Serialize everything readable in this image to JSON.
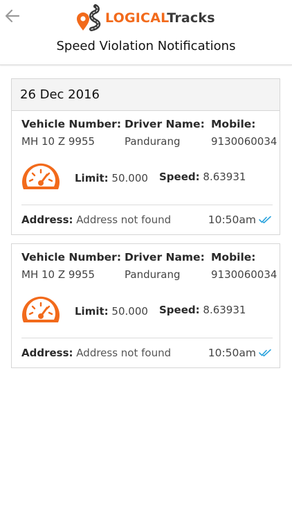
{
  "app": {
    "logo_part1": "LOGICAL",
    "logo_part2": "Tracks",
    "title": "Speed Violation Notifications"
  },
  "colors": {
    "accent": "#f26a1b",
    "check": "#2aa3dd"
  },
  "icons": {
    "back": "arrow-left-icon",
    "speed": "speedometer-icon",
    "read": "double-check-icon"
  },
  "notifications": {
    "date": "26 Dec 2016",
    "items": [
      {
        "vehicle_label": "Vehicle Number:",
        "vehicle_value": "MH 10 Z 9955",
        "driver_label": "Driver Name:",
        "driver_value": "Pandurang",
        "mobile_label": "Mobile:",
        "mobile_value": "9130060034",
        "limit_label": "Limit:",
        "limit_value": "50.000",
        "speed_label": "Speed:",
        "speed_value": "8.63931",
        "address_label": "Address:",
        "address_value": "Address not found",
        "time": "10:50am"
      },
      {
        "vehicle_label": "Vehicle Number:",
        "vehicle_value": "MH 10 Z 9955",
        "driver_label": "Driver Name:",
        "driver_value": "Pandurang",
        "mobile_label": "Mobile:",
        "mobile_value": "9130060034",
        "limit_label": "Limit:",
        "limit_value": "50.000",
        "speed_label": "Speed:",
        "speed_value": "8.63931",
        "address_label": "Address:",
        "address_value": "Address not found",
        "time": "10:50am"
      }
    ]
  }
}
